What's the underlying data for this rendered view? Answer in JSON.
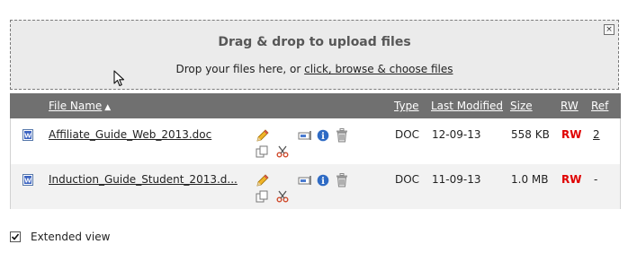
{
  "dropzone": {
    "title": "Drag & drop to upload files",
    "subtitle_prefix": "Drop your files here, or ",
    "subtitle_link": "click, browse & choose files",
    "close_glyph": "×"
  },
  "table": {
    "headers": {
      "file_name": "File Name",
      "sort_indicator": "▲",
      "type": "Type",
      "last_modified": "Last Modified",
      "size": "Size",
      "rw": "RW",
      "ref": "Ref"
    },
    "rows": [
      {
        "file_name": "Affiliate_Guide_Web_2013.doc",
        "type": "DOC",
        "last_modified": "12-09-13",
        "size": "558 KB",
        "rw": "RW",
        "ref": "2"
      },
      {
        "file_name": "Induction_Guide_Student_2013.d...",
        "type": "DOC",
        "last_modified": "11-09-13",
        "size": "1.0 MB",
        "rw": "RW",
        "ref": "-"
      }
    ],
    "row_icons": [
      "edit-pencil-icon",
      "copy-icon",
      "cut-scissors-icon",
      "preview-icon",
      "info-icon",
      "delete-trash-icon"
    ]
  },
  "footer": {
    "extended_view_label": "Extended view",
    "extended_view_checked": true
  },
  "colors": {
    "header_bg": "#707070",
    "dropzone_bg": "#ebebeb",
    "rw_red": "#e00000",
    "info_blue": "#2f6bc4"
  }
}
